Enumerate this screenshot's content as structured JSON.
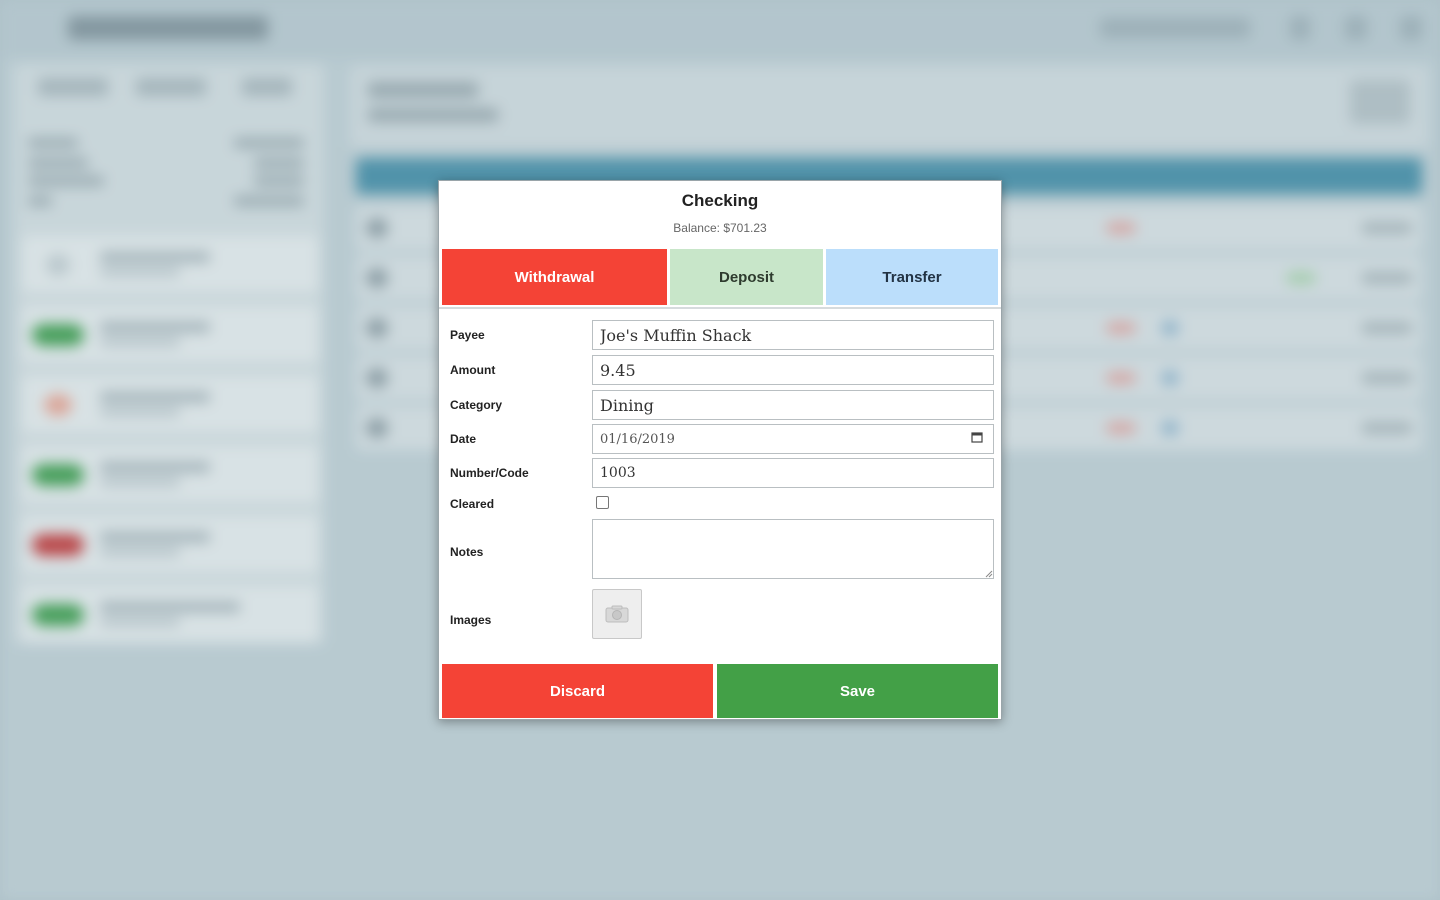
{
  "dialog": {
    "title": "Checking",
    "balance": "Balance: $701.23"
  },
  "tabs": [
    {
      "label": "Withdrawal",
      "active": true,
      "color": "#f44336"
    },
    {
      "label": "Deposit",
      "active": false,
      "color": "#c8e6c9"
    },
    {
      "label": "Transfer",
      "active": false,
      "color": "#bbdefb"
    }
  ],
  "form": {
    "payee": {
      "label": "Payee",
      "value": "Joe's Muffin Shack"
    },
    "amount": {
      "label": "Amount",
      "value": "9.45"
    },
    "category": {
      "label": "Category",
      "value": "Dining"
    },
    "date": {
      "label": "Date",
      "value": "01/16/2019",
      "icon": "calendar-icon"
    },
    "number": {
      "label": "Number/Code",
      "value": "1003"
    },
    "cleared": {
      "label": "Cleared",
      "checked": false
    },
    "notes": {
      "label": "Notes",
      "value": ""
    },
    "images": {
      "label": "Images",
      "icon": "camera-icon"
    }
  },
  "footer": {
    "discard_label": "Discard",
    "save_label": "Save",
    "discard_color": "#f44336",
    "save_color": "#43a047"
  }
}
